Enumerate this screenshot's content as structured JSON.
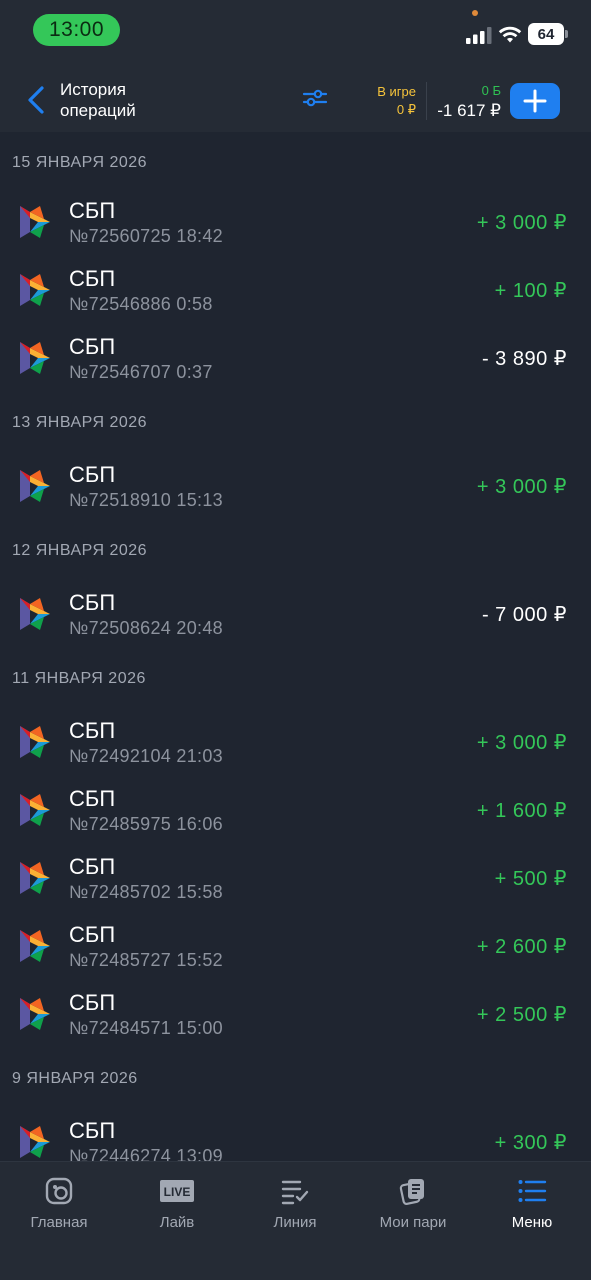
{
  "status_bar": {
    "time": "13:00",
    "battery": "64"
  },
  "header": {
    "back_label": "История",
    "back_label_line2": "операций",
    "in_game_label": "В игре",
    "in_game_value": "0 ₽",
    "bonus_label": "0 Б",
    "balance": "-1 617 ₽"
  },
  "sections": [
    {
      "date": "15 ЯНВАРЯ 2026",
      "operations": [
        {
          "name": "СБП",
          "sub": "№72560725 18:42",
          "amount": "+ 3 000  ₽",
          "sign": "pos"
        },
        {
          "name": "СБП",
          "sub": "№72546886 0:58",
          "amount": "+ 100  ₽",
          "sign": "pos"
        },
        {
          "name": "СБП",
          "sub": "№72546707 0:37",
          "amount": "- 3 890  ₽",
          "sign": "neg"
        }
      ]
    },
    {
      "date": "13 ЯНВАРЯ 2026",
      "operations": [
        {
          "name": "СБП",
          "sub": "№72518910 15:13",
          "amount": "+ 3 000  ₽",
          "sign": "pos"
        }
      ]
    },
    {
      "date": "12 ЯНВАРЯ 2026",
      "operations": [
        {
          "name": "СБП",
          "sub": "№72508624 20:48",
          "amount": "- 7 000  ₽",
          "sign": "neg"
        }
      ]
    },
    {
      "date": "11 ЯНВАРЯ 2026",
      "operations": [
        {
          "name": "СБП",
          "sub": "№72492104 21:03",
          "amount": "+ 3 000  ₽",
          "sign": "pos"
        },
        {
          "name": "СБП",
          "sub": "№72485975 16:06",
          "amount": "+ 1 600  ₽",
          "sign": "pos"
        },
        {
          "name": "СБП",
          "sub": "№72485702 15:58",
          "amount": "+ 500  ₽",
          "sign": "pos"
        },
        {
          "name": "СБП",
          "sub": "№72485727 15:52",
          "amount": "+ 2 600  ₽",
          "sign": "pos"
        },
        {
          "name": "СБП",
          "sub": "№72484571 15:00",
          "amount": "+ 2 500  ₽",
          "sign": "pos"
        }
      ]
    },
    {
      "date": "9 ЯНВАРЯ 2026",
      "operations": [
        {
          "name": "СБП",
          "sub": "№72446274 13:09",
          "amount": "+ 300  ₽",
          "sign": "pos"
        }
      ]
    }
  ],
  "nav": [
    {
      "label": "Главная",
      "icon": "home-icon",
      "active": false
    },
    {
      "label": "Лайв",
      "icon": "live-icon",
      "active": false
    },
    {
      "label": "Линия",
      "icon": "line-list-icon",
      "active": false
    },
    {
      "label": "Мои пари",
      "icon": "my-bets-icon",
      "active": false
    },
    {
      "label": "Меню",
      "icon": "menu-icon",
      "active": true
    }
  ],
  "colors": {
    "background": "#1f2530",
    "accent": "#1f7ff0",
    "positive": "#34c759",
    "in_game": "#f5c33b"
  }
}
